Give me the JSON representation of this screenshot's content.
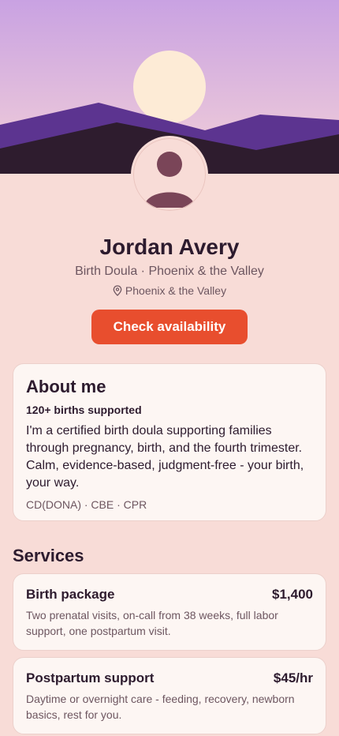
{
  "profile": {
    "name": "Jordan Avery",
    "subtitle": "Birth Doula · Phoenix & the Valley",
    "location": "Phoenix & the Valley",
    "cta_label": "Check availability"
  },
  "about": {
    "title": "About me",
    "stat": "120+ births supported",
    "bio": "I'm a certified birth doula supporting families through pregnancy, birth, and the fourth trimester. Calm, evidence-based, judgment-free - your birth, your way.",
    "credentials": "CD(DONA) · CBE · CPR"
  },
  "services": {
    "title": "Services",
    "items": [
      {
        "name": "Birth package",
        "price": "$1,400",
        "description": "Two prenatal visits, on-call from 38 weeks, full labor support, one postpartum visit."
      },
      {
        "name": "Postpartum support",
        "price": "$45/hr",
        "description": "Daytime or overnight care - feeding, recovery, newborn basics, rest for you."
      }
    ]
  },
  "colors": {
    "accent": "#e84e2e",
    "background": "#f8dcd7",
    "card": "#fdf6f3",
    "text": "#2d1b2e",
    "muted": "#6d5660"
  },
  "icons": {
    "location": "map-pin-icon",
    "avatar": "person-silhouette-icon"
  }
}
